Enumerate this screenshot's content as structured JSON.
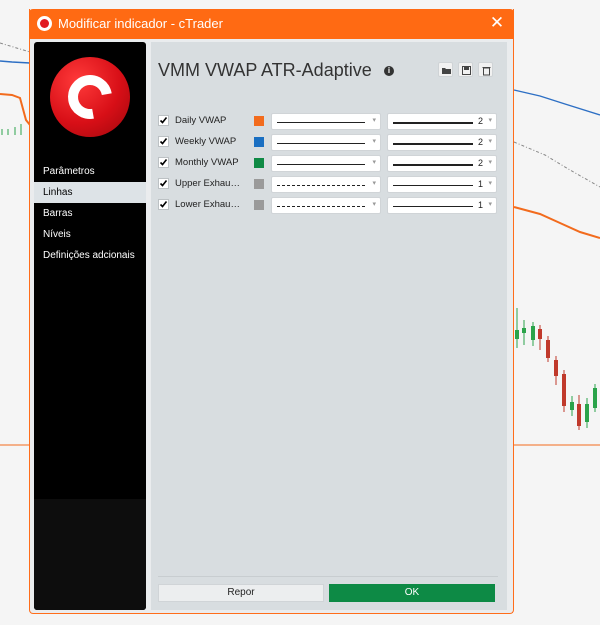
{
  "window": {
    "title": "Modificar indicador - cTrader",
    "close_symbol": "✕"
  },
  "sidebar": {
    "items": [
      {
        "label": "Parâmetros",
        "active": false
      },
      {
        "label": "Linhas",
        "active": true
      },
      {
        "label": "Barras",
        "active": false
      },
      {
        "label": "Níveis",
        "active": false
      },
      {
        "label": "Definições adcionais",
        "active": false
      }
    ]
  },
  "indicator": {
    "name": "VMM VWAP ATR-Adaptive"
  },
  "toolbar_icons": [
    "open-folder-icon",
    "save-icon",
    "trash-icon"
  ],
  "lines": [
    {
      "label": "Daily VWAP",
      "checked": true,
      "color": "#f26b1d",
      "style": "solid",
      "width": "2"
    },
    {
      "label": "Weekly VWAP",
      "checked": true,
      "color": "#1a6fc2",
      "style": "solid",
      "width": "2"
    },
    {
      "label": "Monthly VWAP",
      "checked": true,
      "color": "#0f8a45",
      "style": "solid",
      "width": "2"
    },
    {
      "label": "Upper Exhau…",
      "checked": true,
      "color": "#9a9a9a",
      "style": "dash-dot",
      "width": "1"
    },
    {
      "label": "Lower Exhau…",
      "checked": true,
      "color": "#9a9a9a",
      "style": "dash-dot",
      "width": "1"
    }
  ],
  "buttons": {
    "reset": "Repor",
    "ok": "OK"
  },
  "colors": {
    "accent": "#ff6a13",
    "ok": "#0d8a45",
    "sidebar": "#000000",
    "panel": "#d8dde0"
  }
}
